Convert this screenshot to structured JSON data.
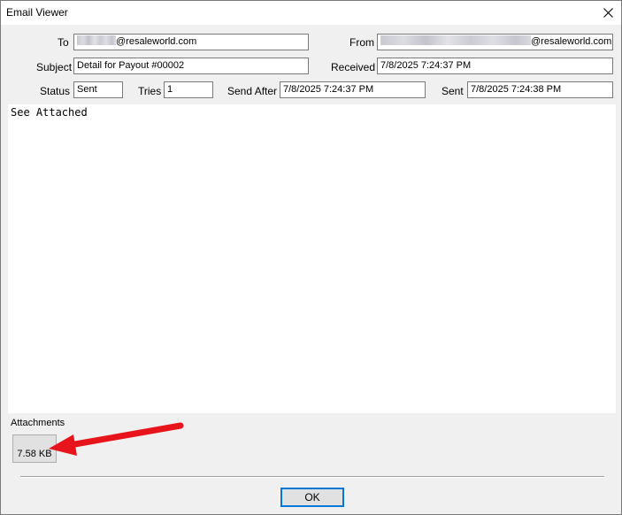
{
  "window": {
    "title": "Email Viewer",
    "close_icon": "close-icon"
  },
  "fields": {
    "to_label": "To",
    "to_domain": "@resaleworld.com",
    "from_label": "From",
    "from_domain": "@resaleworld.com",
    "subject_label": "Subject",
    "subject_value": "Detail for Payout #00002",
    "received_label": "Received",
    "received_value": "7/8/2025 7:24:37 PM",
    "status_label": "Status",
    "status_value": "Sent",
    "tries_label": "Tries",
    "tries_value": "1",
    "send_after_label": "Send After",
    "send_after_value": "7/8/2025 7:24:37 PM",
    "sent_label": "Sent",
    "sent_value": "7/8/2025 7:24:38 PM"
  },
  "body": {
    "text": "See Attached"
  },
  "attachments": {
    "label": "Attachments",
    "items": [
      {
        "size": "7.58 KB"
      }
    ]
  },
  "buttons": {
    "ok_label": "OK"
  },
  "colors": {
    "annotation_arrow": "#e8141b",
    "focus_border": "#0078d7"
  }
}
